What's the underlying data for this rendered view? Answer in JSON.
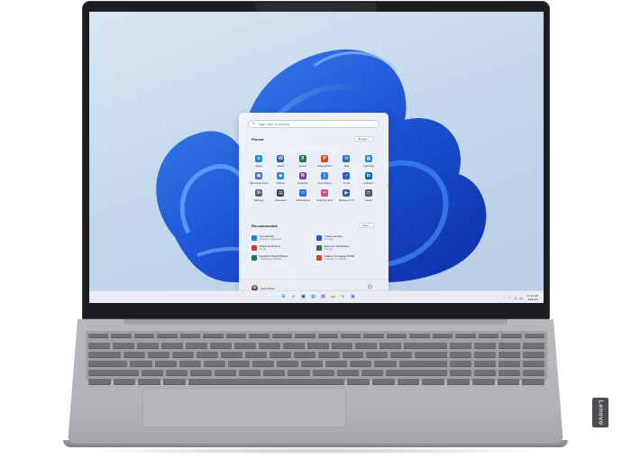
{
  "start_menu": {
    "search_placeholder": "Type here to search",
    "pinned": {
      "title": "Pinned",
      "all_apps_label": "All apps  >",
      "apps": [
        {
          "label": "Edge",
          "icon": "edge-icon",
          "color": "#1d8fd8",
          "glyph": "e"
        },
        {
          "label": "Word",
          "icon": "word-icon",
          "color": "#2b5cb8",
          "glyph": "W"
        },
        {
          "label": "Excel",
          "icon": "excel-icon",
          "color": "#1f7a45",
          "glyph": "X"
        },
        {
          "label": "PowerPoint",
          "icon": "powerpoint-icon",
          "color": "#d04a2a",
          "glyph": "P"
        },
        {
          "label": "Mail",
          "icon": "mail-icon",
          "color": "#1a73d1",
          "glyph": "✉"
        },
        {
          "label": "Calendar",
          "icon": "calendar-icon",
          "color": "#2f7fd7",
          "glyph": "▦"
        },
        {
          "label": "Microsoft Store",
          "icon": "store-icon",
          "color": "#3b6fd1",
          "glyph": "▣"
        },
        {
          "label": "Photos",
          "icon": "photos-icon",
          "color": "#2a8ad6",
          "glyph": "◆"
        },
        {
          "label": "OneNote",
          "icon": "onenote-icon",
          "color": "#7a3bb0",
          "glyph": "N"
        },
        {
          "label": "Your Phone",
          "icon": "phone-icon",
          "color": "#3a7be0",
          "glyph": "▯"
        },
        {
          "label": "To Do",
          "icon": "todo-icon",
          "color": "#2564cf",
          "glyph": "✓"
        },
        {
          "label": "LinkedIn",
          "icon": "linkedin-icon",
          "color": "#0a66c2",
          "glyph": "in"
        },
        {
          "label": "Settings",
          "icon": "settings-icon",
          "color": "#5b6270",
          "glyph": "⚙"
        },
        {
          "label": "Calculator",
          "icon": "calculator-icon",
          "color": "#3b3f46",
          "glyph": "▤"
        },
        {
          "label": "Whiteboard",
          "icon": "whiteboard-icon",
          "color": "#2f6fd6",
          "glyph": "▭"
        },
        {
          "label": "Snipping Tool",
          "icon": "snipping-icon",
          "color": "#d24b8a",
          "glyph": "✂"
        },
        {
          "label": "Movies & TV",
          "icon": "movies-icon",
          "color": "#2a5bb5",
          "glyph": "▶"
        },
        {
          "label": "Clock",
          "icon": "clock-icon",
          "color": "#4a5260",
          "glyph": "◷"
        }
      ]
    },
    "recommended": {
      "title": "Recommended",
      "more_label": "More  >",
      "items": [
        {
          "title": "Get Started",
          "sub": "Welcome to Windows",
          "icon": "get-started-icon",
          "color": "#2f7fd7"
        },
        {
          "title": "Travel Itinerary",
          "sub": "17m ago",
          "icon": "word-doc-icon",
          "color": "#2b5cb8"
        },
        {
          "title": "Brand Guidelines",
          "sub": "2h ago",
          "icon": "pdf-icon",
          "color": "#c83a2e"
        },
        {
          "title": "Expense Worksheet",
          "sub": "12h ago",
          "icon": "excel-doc-icon",
          "color": "#1f7a45"
        },
        {
          "title": "Quarterly Payroll Report",
          "sub": "Yesterday at 4:24 PM",
          "icon": "excel-doc-icon",
          "color": "#1f7a45"
        },
        {
          "title": "Adatum Company Profile",
          "sub": "Yesterday at 1:15 PM",
          "icon": "powerpoint-doc-icon",
          "color": "#d04a2a"
        }
      ]
    },
    "user_name": "Sara Philips"
  },
  "taskbar": {
    "icons": [
      {
        "name": "start-icon",
        "glyph": "⊞",
        "color": "#1a73d1"
      },
      {
        "name": "search-icon",
        "glyph": "⌕",
        "color": "#333333"
      },
      {
        "name": "task-view-icon",
        "glyph": "▣",
        "color": "#333333"
      },
      {
        "name": "widgets-icon",
        "glyph": "▦",
        "color": "#2f7fd7"
      },
      {
        "name": "chat-icon",
        "glyph": "▩",
        "color": "#6b5bd6"
      },
      {
        "name": "file-explorer-icon",
        "glyph": "▬",
        "color": "#e0a422"
      },
      {
        "name": "edge-icon",
        "glyph": "e",
        "color": "#1d8fd8"
      },
      {
        "name": "store-icon",
        "glyph": "▣",
        "color": "#3b6fd1"
      }
    ],
    "tray": {
      "time": "11:11 AM",
      "date": "10/20/21"
    }
  },
  "brand": "Lenovo",
  "colors": {
    "accent": "#1a73d1",
    "bloom": "#1f5fe0",
    "deck": "#b0b2b6"
  }
}
